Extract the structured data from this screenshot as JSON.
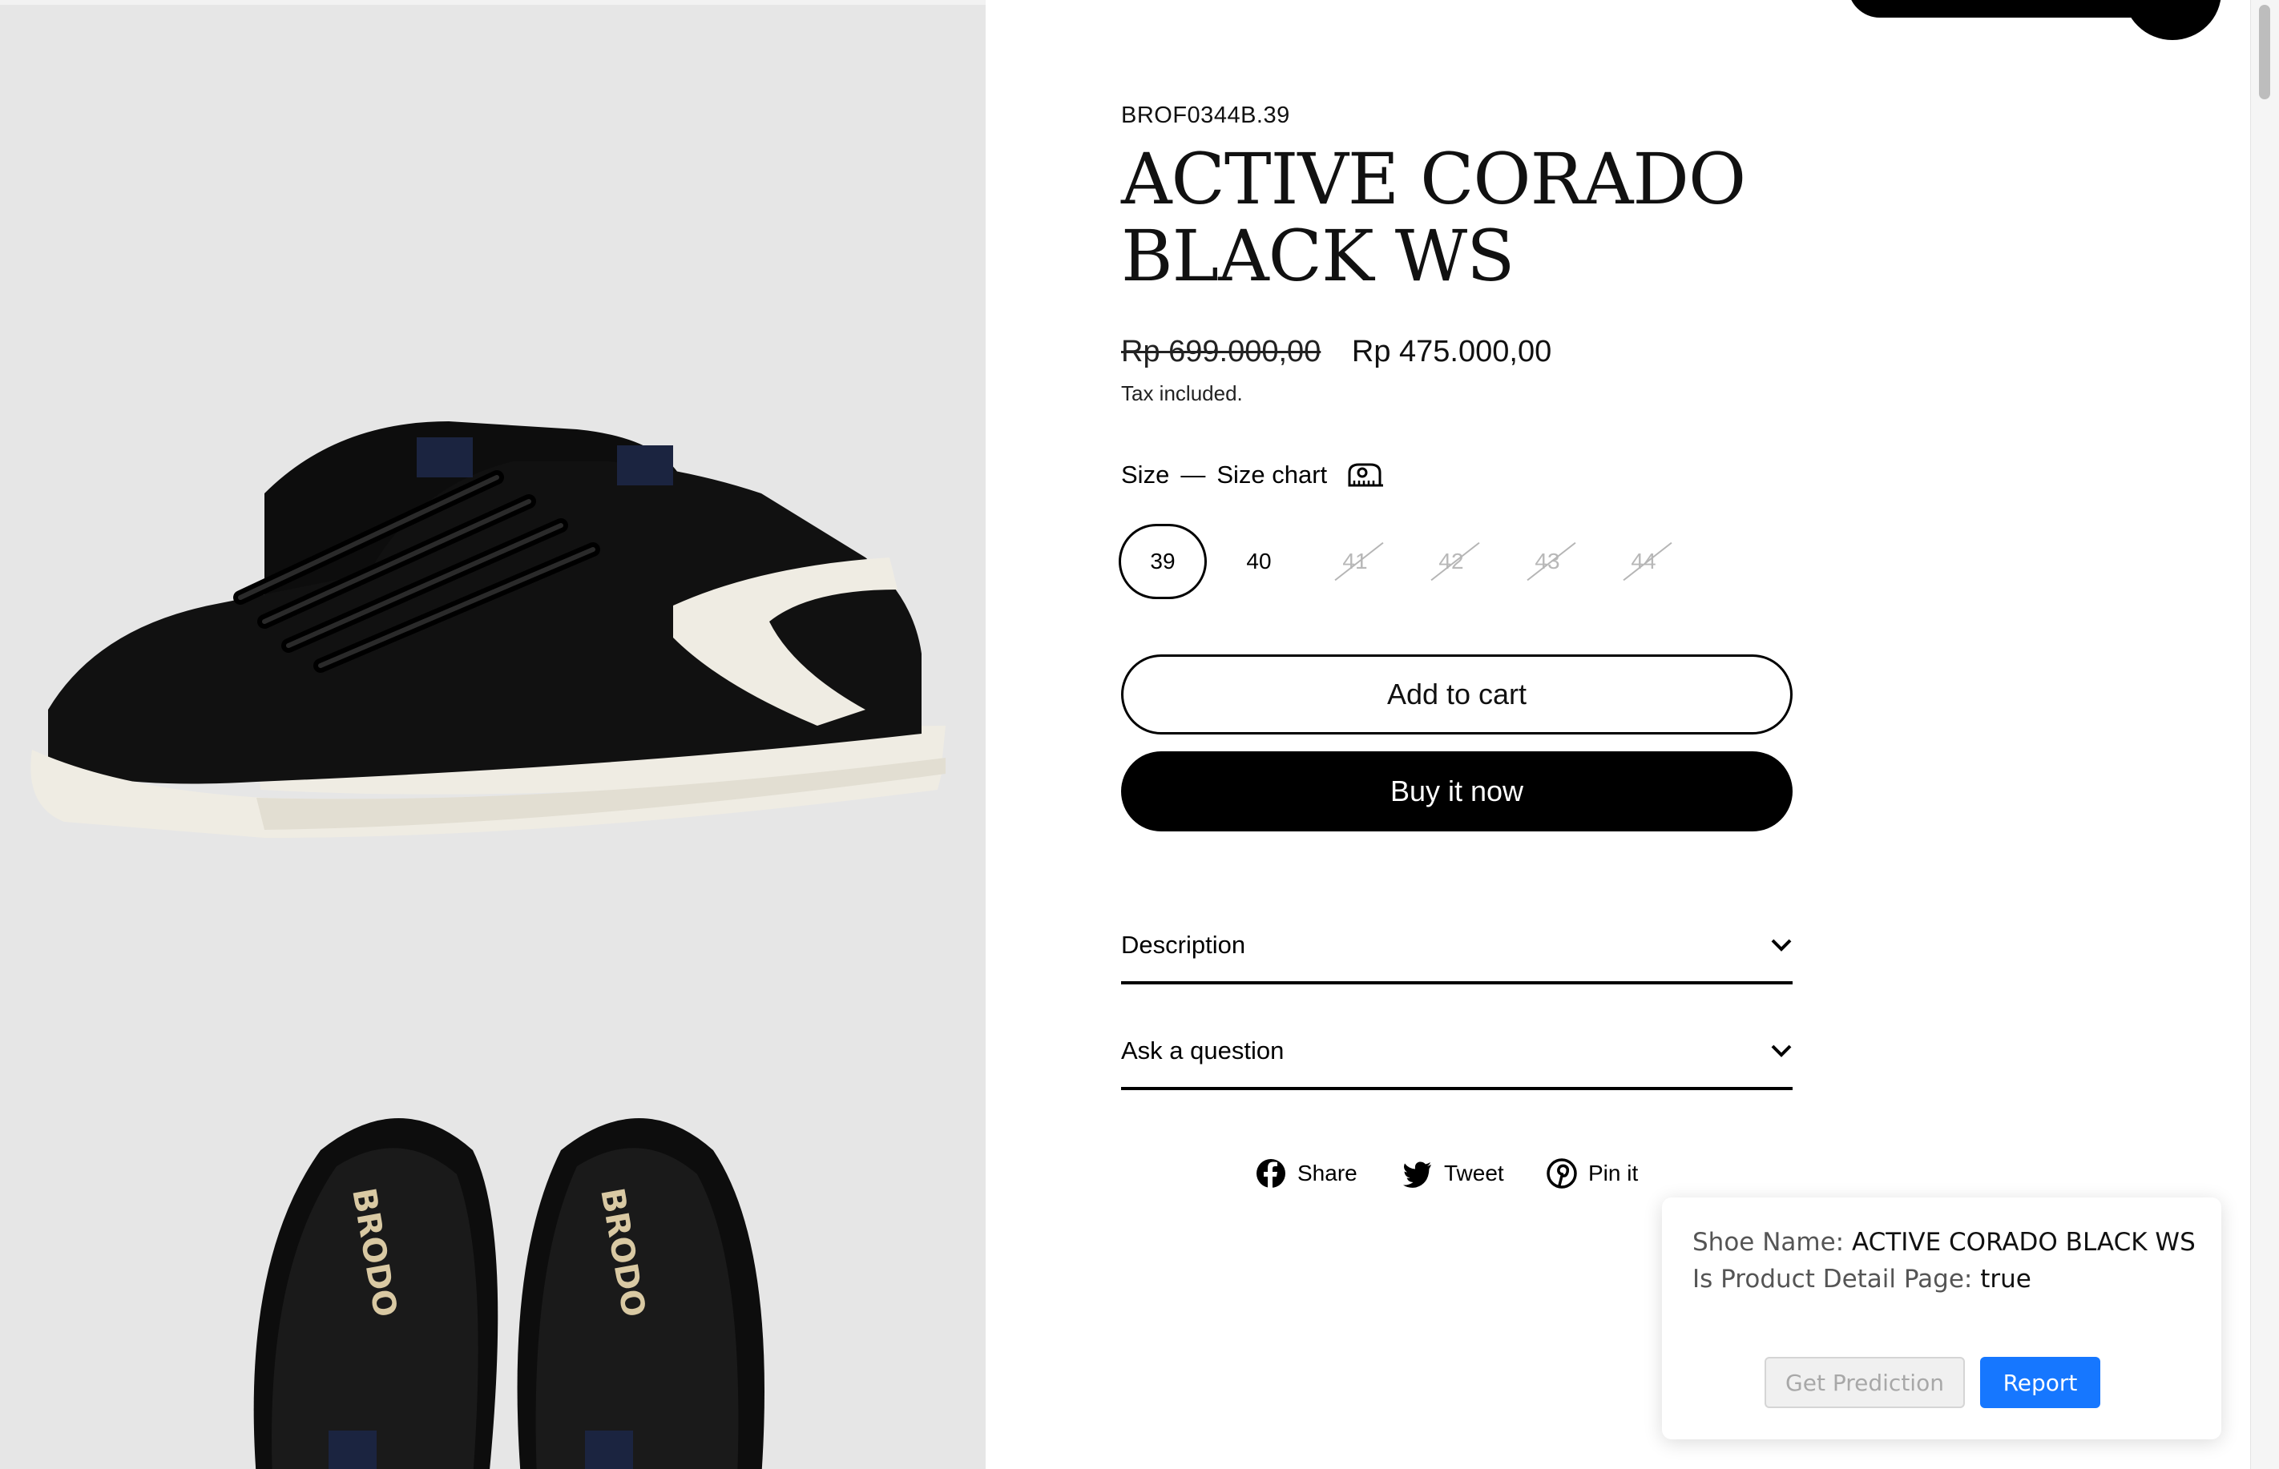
{
  "product": {
    "sku": "BROF0344B.39",
    "title": "ACTIVE CORADO BLACK WS",
    "price_original": "Rp 699.000,00",
    "price_sale": "Rp 475.000,00",
    "tax_note": "Tax included."
  },
  "size_selector": {
    "label": "Size",
    "separator": "—",
    "chart_link": "Size chart",
    "options": [
      {
        "label": "39",
        "state": "selected"
      },
      {
        "label": "40",
        "state": "available"
      },
      {
        "label": "41",
        "state": "unavailable"
      },
      {
        "label": "42",
        "state": "unavailable"
      },
      {
        "label": "43",
        "state": "unavailable"
      },
      {
        "label": "44",
        "state": "unavailable"
      }
    ]
  },
  "actions": {
    "add_to_cart": "Add to cart",
    "buy_now": "Buy it now"
  },
  "accordions": {
    "description": "Description",
    "ask": "Ask a question"
  },
  "social": {
    "share": "Share",
    "tweet": "Tweet",
    "pin": "Pin it"
  },
  "gallery": {
    "brand_mark": "BRODO"
  },
  "extension_popup": {
    "shoe_name_label": "Shoe Name:",
    "shoe_name_value": "ACTIVE CORADO BLACK WS",
    "pdp_label": "Is Product Detail Page:",
    "pdp_value": "true",
    "predict_button": "Get Prediction",
    "report_button": "Report"
  },
  "icons": [
    "ruler-icon",
    "chevron-down-icon",
    "facebook-icon",
    "twitter-icon",
    "pinterest-icon"
  ],
  "colors": {
    "primary": "#000000",
    "gallery_bg": "#e6e6e6",
    "report_button": "#1677ff",
    "unavailable": "#b8b8b8"
  }
}
